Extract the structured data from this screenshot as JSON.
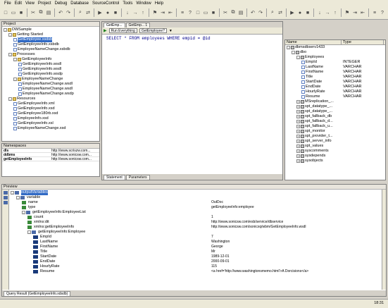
{
  "menubar": [
    "File",
    "Edit",
    "View",
    "Project",
    "Debug",
    "Database",
    "SourceControl",
    "Tools",
    "Window",
    "Help"
  ],
  "project": {
    "title": "Project",
    "items": [
      {
        "label": "DWSample",
        "indent": 0,
        "type": "folder",
        "exp": "-"
      },
      {
        "label": "Getting Started",
        "indent": 1,
        "type": "folder",
        "exp": "-"
      },
      {
        "label": "GetEmployee.xsdsb",
        "indent": 2,
        "type": "file",
        "selected": true
      },
      {
        "label": "GetEmployeeInfo.xsbdb",
        "indent": 2,
        "type": "file"
      },
      {
        "label": "EmployeeNameChange.xsbdb",
        "indent": 2,
        "type": "file"
      },
      {
        "label": "Processes",
        "indent": 1,
        "type": "folder",
        "exp": "-"
      },
      {
        "label": "GetEmployeeInfo",
        "indent": 2,
        "type": "folder",
        "exp": "-"
      },
      {
        "label": "GetEmployeeInfo.wsdl",
        "indent": 3,
        "type": "file"
      },
      {
        "label": "GetEmployeeInfo.wsdl",
        "indent": 3,
        "type": "file"
      },
      {
        "label": "GetEmployeeInfo.wsdp",
        "indent": 3,
        "type": "file"
      },
      {
        "label": "EmployeeNameChange",
        "indent": 2,
        "type": "folder",
        "exp": "-"
      },
      {
        "label": "EmployeeNameChange.wsdl",
        "indent": 3,
        "type": "file"
      },
      {
        "label": "EmployeeNameChange.wsdl",
        "indent": 3,
        "type": "file"
      },
      {
        "label": "EmployeeNameChange.wsdp",
        "indent": 3,
        "type": "file"
      },
      {
        "label": "Resources",
        "indent": 1,
        "type": "folder",
        "exp": "-"
      },
      {
        "label": "GetEmployeeInfo.xml",
        "indent": 2,
        "type": "file"
      },
      {
        "label": "GetEmployeeInfo.xsd",
        "indent": 2,
        "type": "file"
      },
      {
        "label": "GetEmployee180rb.xsd",
        "indent": 2,
        "type": "file"
      },
      {
        "label": "EmployeeInfo.xsd",
        "indent": 2,
        "type": "file"
      },
      {
        "label": "GetEmployeeInfo.xsl",
        "indent": 2,
        "type": "file"
      },
      {
        "label": "EmployeeNameChange.xsd",
        "indent": 2,
        "type": "file"
      }
    ]
  },
  "namespaces": {
    "title": "Namespaces",
    "rows": [
      {
        "prefix": "dls",
        "uri": "http://www.scriszw.com..."
      },
      {
        "prefix": "ddbms",
        "uri": "http://www.sonicsw.com..."
      },
      {
        "prefix": "getEmployeeInfo",
        "uri": "http://www.sonicsw.com..."
      }
    ]
  },
  "editor": {
    "tabs": [
      "GetEmp...",
      "GetEmp... 1"
    ],
    "combo1": "Run Everything",
    "combo2": "GetEmployee?",
    "sql": "SELECT * FROM employees WHERE empid = @id",
    "bottom_tabs": [
      "Statement",
      "Parameters"
    ]
  },
  "db": {
    "col_name": "Name",
    "col_type": "Type",
    "rows": [
      {
        "label": "dbmsdbserv1433",
        "indent": 0,
        "exp": "-",
        "type": ""
      },
      {
        "label": "dbo",
        "indent": 1,
        "exp": "-",
        "type": ""
      },
      {
        "label": "Employees",
        "indent": 2,
        "exp": "-",
        "type": ""
      },
      {
        "label": "EmpId",
        "indent": 3,
        "type": "INTEGER"
      },
      {
        "label": "LastName",
        "indent": 3,
        "type": "VARCHAR"
      },
      {
        "label": "FirstName",
        "indent": 3,
        "type": "VARCHAR"
      },
      {
        "label": "Title",
        "indent": 3,
        "type": "VARCHAR"
      },
      {
        "label": "StartDate",
        "indent": 3,
        "type": "VARCHAR"
      },
      {
        "label": "EndDate",
        "indent": 3,
        "type": "VARCHAR"
      },
      {
        "label": "HourlyRate",
        "indent": 3,
        "type": "VARCHAR"
      },
      {
        "label": "Resume",
        "indent": 3,
        "type": "VARCHAR"
      },
      {
        "label": "MSreplication_...",
        "indent": 2,
        "exp": "+",
        "type": ""
      },
      {
        "label": "spt_datatype_...",
        "indent": 2,
        "exp": "+",
        "type": ""
      },
      {
        "label": "spt_datatype_...",
        "indent": 2,
        "exp": "+",
        "type": ""
      },
      {
        "label": "spt_fallback_db",
        "indent": 2,
        "exp": "+",
        "type": ""
      },
      {
        "label": "spt_fallback_d...",
        "indent": 2,
        "exp": "+",
        "type": ""
      },
      {
        "label": "spt_fallback_u...",
        "indent": 2,
        "exp": "+",
        "type": ""
      },
      {
        "label": "spt_monitor",
        "indent": 2,
        "exp": "+",
        "type": ""
      },
      {
        "label": "spt_provider_t...",
        "indent": 2,
        "exp": "+",
        "type": ""
      },
      {
        "label": "spt_server_info",
        "indent": 2,
        "exp": "+",
        "type": ""
      },
      {
        "label": "spt_values",
        "indent": 2,
        "exp": "+",
        "type": ""
      },
      {
        "label": "syscomments",
        "indent": 2,
        "exp": "+",
        "type": ""
      },
      {
        "label": "sysdepends",
        "indent": 2,
        "exp": "+",
        "type": ""
      },
      {
        "label": "sysobjects",
        "indent": 2,
        "exp": "+",
        "type": ""
      }
    ]
  },
  "preview": {
    "title": "Preview",
    "rows": [
      {
        "label": "outputVariables",
        "indent": 0,
        "exp": "-",
        "icon": "ib",
        "selected": true,
        "value": ""
      },
      {
        "label": "variable",
        "indent": 1,
        "exp": "-",
        "icon": "ib",
        "value": ""
      },
      {
        "label": "name",
        "indent": 2,
        "icon": "g",
        "value": "OutDoc"
      },
      {
        "label": "type",
        "indent": 2,
        "icon": "g",
        "value": "getEmployeeInfo:employee"
      },
      {
        "label": "getEmployeeInfo:EmployeeList",
        "indent": 2,
        "exp": "-",
        "icon": "ib",
        "value": ""
      },
      {
        "label": "count",
        "indent": 3,
        "icon": "g",
        "value": "1"
      },
      {
        "label": "xmlns:dit",
        "indent": 3,
        "icon": "g",
        "value": "http://www.sonicsw.com/esb/service/dbservice"
      },
      {
        "label": "xmlns:getEmployeeInfo",
        "indent": 3,
        "icon": "g",
        "value": "http://www.sonicsw.com/sonicxq/wbm/GetEmployeeInfo.wsdl"
      },
      {
        "label": "getEmployeeInfo:Employee",
        "indent": 3,
        "exp": "-",
        "icon": "ib",
        "value": ""
      },
      {
        "label": "EmpId",
        "indent": 4,
        "icon": "leaf",
        "value": "7"
      },
      {
        "label": "LastName",
        "indent": 4,
        "icon": "leaf",
        "value": "Washington"
      },
      {
        "label": "FirstName",
        "indent": 4,
        "icon": "leaf",
        "value": "George"
      },
      {
        "label": "Title",
        "indent": 4,
        "icon": "leaf",
        "value": "Mr"
      },
      {
        "label": "StartDate",
        "indent": 4,
        "icon": "leaf",
        "value": "1989-12-01"
      },
      {
        "label": "EndDate",
        "indent": 4,
        "icon": "leaf",
        "value": "2000-09-01"
      },
      {
        "label": "HourlyRate",
        "indent": 4,
        "icon": "leaf",
        "value": "115"
      },
      {
        "label": "Resume",
        "indent": 4,
        "icon": "leaf",
        "value": "<a href='http://www.washingtonsmemo.html'>A Dorcisions</a>"
      }
    ],
    "bottom_tab": "Query Result (GetEmployeeInfo.xdsdb)"
  },
  "status": {
    "position": "18:31"
  }
}
